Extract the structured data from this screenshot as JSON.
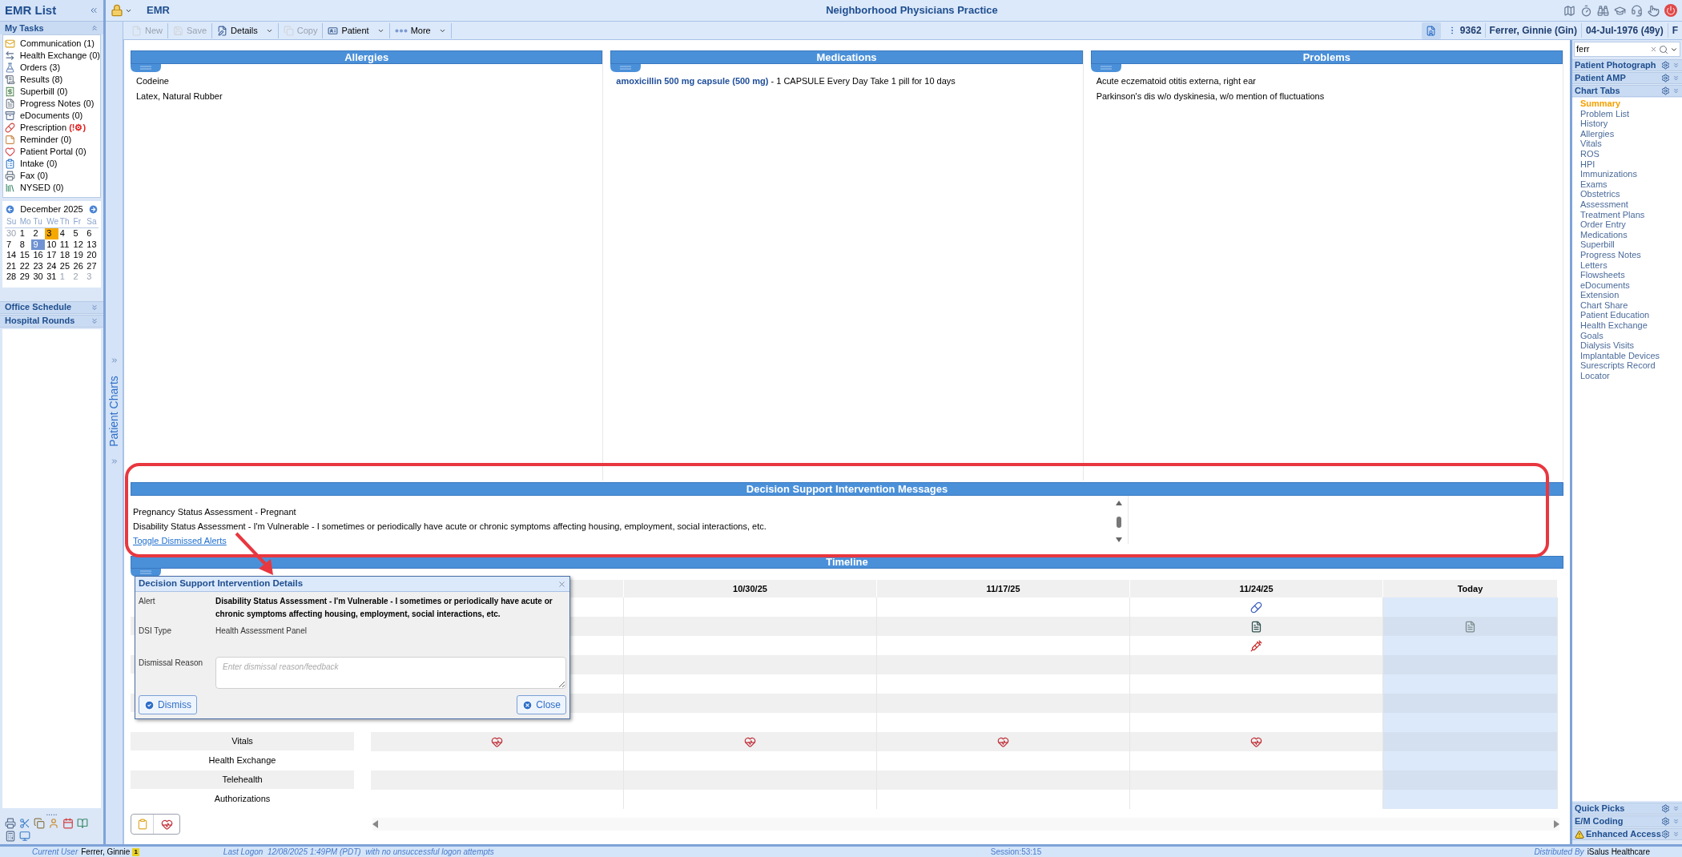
{
  "emr_list": {
    "title": "EMR List",
    "my_tasks": "My Tasks",
    "tasks": [
      {
        "label": "Communication",
        "count": "(1)",
        "kind": "mail",
        "alert": false
      },
      {
        "label": "Health Exchange",
        "count": "(0)",
        "kind": "exchange",
        "alert": false
      },
      {
        "label": "Orders",
        "count": "(3)",
        "kind": "flask",
        "alert": false
      },
      {
        "label": "Results",
        "count": "(8)",
        "kind": "results",
        "alert": false
      },
      {
        "label": "Superbill",
        "count": "(0)",
        "kind": "bill",
        "alert": false
      },
      {
        "label": "Progress Notes",
        "count": "(0)",
        "kind": "notes",
        "alert": false
      },
      {
        "label": "eDocuments",
        "count": "(0)",
        "kind": "cabinet",
        "alert": false
      },
      {
        "label": "Prescription",
        "count": "(!⚙)",
        "kind": "pill",
        "alert": true
      },
      {
        "label": "Reminder",
        "count": "(0)",
        "kind": "sticky",
        "alert": false
      },
      {
        "label": "Patient Portal",
        "count": "(0)",
        "kind": "heart",
        "alert": false
      },
      {
        "label": "Intake",
        "count": "(0)",
        "kind": "intake",
        "alert": false
      },
      {
        "label": "Fax",
        "count": "(0)",
        "kind": "fax",
        "alert": false
      },
      {
        "label": "NYSED",
        "count": "(0)",
        "kind": "books",
        "alert": false
      }
    ],
    "sections": [
      "Office Schedule",
      "Hospital Rounds"
    ],
    "handle": "....."
  },
  "calendar": {
    "month": "December 2025",
    "weekdays": [
      "Su",
      "Mo",
      "Tu",
      "We",
      "Th",
      "Fr",
      "Sa"
    ],
    "weeks": [
      [
        {
          "d": "30",
          "kind": "other",
          "selected": false
        },
        {
          "d": "1",
          "kind": "day",
          "selected": false
        },
        {
          "d": "2",
          "kind": "day",
          "selected": false
        },
        {
          "d": "3",
          "kind": "marked",
          "selected": false
        },
        {
          "d": "4",
          "kind": "day",
          "selected": false
        },
        {
          "d": "5",
          "kind": "day",
          "selected": false
        },
        {
          "d": "6",
          "kind": "day",
          "selected": false
        }
      ],
      [
        {
          "d": "7",
          "kind": "day",
          "selected": false
        },
        {
          "d": "8",
          "kind": "day",
          "selected": false
        },
        {
          "d": "9",
          "kind": "day",
          "selected": true
        },
        {
          "d": "10",
          "kind": "day",
          "selected": false
        },
        {
          "d": "11",
          "kind": "day",
          "selected": false
        },
        {
          "d": "12",
          "kind": "day",
          "selected": false
        },
        {
          "d": "13",
          "kind": "day",
          "selected": false
        }
      ],
      [
        {
          "d": "14",
          "kind": "day",
          "selected": false
        },
        {
          "d": "15",
          "kind": "day",
          "selected": false
        },
        {
          "d": "16",
          "kind": "day",
          "selected": false
        },
        {
          "d": "17",
          "kind": "day",
          "selected": false
        },
        {
          "d": "18",
          "kind": "day",
          "selected": false
        },
        {
          "d": "19",
          "kind": "day",
          "selected": false
        },
        {
          "d": "20",
          "kind": "day",
          "selected": false
        }
      ],
      [
        {
          "d": "21",
          "kind": "day",
          "selected": false
        },
        {
          "d": "22",
          "kind": "day",
          "selected": false
        },
        {
          "d": "23",
          "kind": "day",
          "selected": false
        },
        {
          "d": "24",
          "kind": "day",
          "selected": false
        },
        {
          "d": "25",
          "kind": "day",
          "selected": false
        },
        {
          "d": "26",
          "kind": "day",
          "selected": false
        },
        {
          "d": "27",
          "kind": "day",
          "selected": false
        }
      ],
      [
        {
          "d": "28",
          "kind": "day",
          "selected": false
        },
        {
          "d": "29",
          "kind": "day",
          "selected": false
        },
        {
          "d": "30",
          "kind": "day",
          "selected": false
        },
        {
          "d": "31",
          "kind": "day",
          "selected": false
        },
        {
          "d": "1",
          "kind": "other",
          "selected": false
        },
        {
          "d": "2",
          "kind": "other",
          "selected": false
        },
        {
          "d": "3",
          "kind": "other",
          "selected": false
        }
      ]
    ]
  },
  "app": {
    "module": "EMR",
    "practice": "Neighborhood Physicians Practice",
    "side_tab": "Patient Charts"
  },
  "toolbar": {
    "buttons": [
      {
        "label": "New",
        "kind": "new",
        "disabled": true,
        "dropdown": false
      },
      {
        "label": "Save",
        "kind": "save",
        "disabled": true,
        "dropdown": false
      },
      {
        "label": "Details",
        "kind": "details",
        "disabled": false,
        "dropdown": true
      },
      {
        "label": "Copy",
        "kind": "copy",
        "disabled": true,
        "dropdown": false
      },
      {
        "label": "Patient",
        "kind": "patient",
        "disabled": false,
        "dropdown": true
      },
      {
        "label": "More",
        "kind": "more",
        "disabled": false,
        "dropdown": true
      }
    ]
  },
  "patient": {
    "id": "9362",
    "name": "Ferrer, Ginnie (Gin)",
    "dob": "04-Jul-1976 (49y)",
    "sex": "F"
  },
  "panels": [
    {
      "title": "Allergies",
      "lines": [
        "Codeine",
        "Latex, Natural Rubber"
      ]
    },
    {
      "title": "Medications",
      "lines": [
        "**amoxicillin 500 mg capsule (500 mg)** - 1 CAPSULE Every Day Take 1 pill for 10 days"
      ]
    },
    {
      "title": "Problems",
      "lines": [
        "Acute eczematoid otitis externa, right ear",
        "Parkinson's dis w/o dyskinesia, w/o mention of fluctuations"
      ]
    }
  ],
  "dsi": {
    "title": "Decision Support Intervention Messages",
    "alerts": [
      "Pregnancy Status Assessment - Pregnant",
      "Disability Status Assessment - I'm Vulnerable - I sometimes or periodically have acute or chronic symptoms affecting housing, employment, social interactions, etc."
    ],
    "toggle_link": "Toggle Dismissed Alerts"
  },
  "timeline": {
    "title": "Timeline",
    "columns": [
      {
        "label": "10/30/25",
        "today": false
      },
      {
        "label": "11/17/25",
        "today": false
      },
      {
        "label": "11/24/25",
        "today": false
      },
      {
        "label": "Today",
        "today": true
      }
    ],
    "rows": [
      {
        "cells": [
          {
            "kind": "empty"
          },
          {
            "kind": "empty"
          },
          {
            "kind": "empty"
          },
          {
            "kind": "pills"
          },
          {
            "kind": "empty"
          }
        ]
      },
      {
        "cells": [
          {
            "kind": "empty"
          },
          {
            "kind": "empty"
          },
          {
            "kind": "empty"
          },
          {
            "kind": "document"
          },
          {
            "kind": "draft"
          }
        ]
      },
      {
        "cells": [
          {
            "kind": "empty"
          },
          {
            "kind": "empty"
          },
          {
            "kind": "empty"
          },
          {
            "kind": "syringe"
          },
          {
            "kind": "empty"
          }
        ]
      },
      {
        "cells": [
          {
            "kind": "empty"
          },
          {
            "kind": "empty"
          },
          {
            "kind": "empty"
          },
          {
            "kind": "empty"
          },
          {
            "kind": "empty"
          }
        ]
      },
      {
        "cells": [
          {
            "kind": "empty"
          },
          {
            "kind": "empty"
          },
          {
            "kind": "empty"
          },
          {
            "kind": "empty"
          },
          {
            "kind": "empty"
          }
        ]
      },
      {
        "cells": [
          {
            "kind": "empty"
          },
          {
            "kind": "empty"
          },
          {
            "kind": "empty"
          },
          {
            "kind": "empty"
          },
          {
            "kind": "empty"
          }
        ]
      },
      {
        "cells": [
          {
            "kind": "empty"
          },
          {
            "kind": "empty"
          },
          {
            "kind": "empty"
          },
          {
            "kind": "empty"
          },
          {
            "kind": "empty"
          }
        ]
      },
      {
        "label": "Vitals",
        "cells": [
          {
            "kind": "heart"
          },
          {
            "kind": "heart"
          },
          {
            "kind": "heart"
          },
          {
            "kind": "heart"
          },
          {
            "kind": "empty"
          }
        ]
      },
      {
        "label": "Health Exchange",
        "cells": [
          {
            "kind": "empty"
          },
          {
            "kind": "empty"
          },
          {
            "kind": "empty"
          },
          {
            "kind": "empty"
          },
          {
            "kind": "empty"
          }
        ]
      },
      {
        "label": "Telehealth",
        "cells": [
          {
            "kind": "empty"
          },
          {
            "kind": "empty"
          },
          {
            "kind": "empty"
          },
          {
            "kind": "empty"
          },
          {
            "kind": "empty"
          }
        ]
      },
      {
        "label": "Authorizations",
        "cells": [
          {
            "kind": "empty"
          },
          {
            "kind": "empty"
          },
          {
            "kind": "empty"
          },
          {
            "kind": "empty"
          },
          {
            "kind": "empty"
          }
        ]
      }
    ]
  },
  "dialog": {
    "title": "Decision Support Intervention Details",
    "fields": [
      {
        "label": "Alert",
        "kind": "bold",
        "value": "Disability Status Assessment - I'm Vulnerable - I sometimes or periodically have acute or chronic symptoms affecting housing, employment, social interactions, etc."
      },
      {
        "label": "DSI Type",
        "kind": "text",
        "value": "Health Assessment Panel"
      },
      {
        "label": "Dismissal Reason",
        "kind": "textarea",
        "placeholder": "Enter dismissal reason/feedback"
      }
    ],
    "buttons": [
      {
        "label": "Dismiss",
        "kind": "check"
      },
      {
        "label": "Close",
        "kind": "close"
      }
    ]
  },
  "right_panel": {
    "search": {
      "value": "ferr"
    },
    "sections": [
      "Patient Photograph",
      "Patient AMP",
      "Chart Tabs"
    ],
    "chart_tabs": [
      {
        "label": "Summary",
        "selected": true
      },
      {
        "label": "Problem List",
        "selected": false
      },
      {
        "label": "History",
        "selected": false
      },
      {
        "label": "Allergies",
        "selected": false
      },
      {
        "label": "Vitals",
        "selected": false
      },
      {
        "label": "ROS",
        "selected": false
      },
      {
        "label": "HPI",
        "selected": false
      },
      {
        "label": "Immunizations",
        "selected": false
      },
      {
        "label": "Exams",
        "selected": false
      },
      {
        "label": "Obstetrics",
        "selected": false
      },
      {
        "label": "Assessment",
        "selected": false
      },
      {
        "label": "Treatment Plans",
        "selected": false
      },
      {
        "label": "Order Entry",
        "selected": false
      },
      {
        "label": "Medications",
        "selected": false
      },
      {
        "label": "Superbill",
        "selected": false
      },
      {
        "label": "Progress Notes",
        "selected": false
      },
      {
        "label": "Letters",
        "selected": false
      },
      {
        "label": "Flowsheets",
        "selected": false
      },
      {
        "label": "eDocuments",
        "selected": false
      },
      {
        "label": "Extension",
        "selected": false
      },
      {
        "label": "Chart Share",
        "selected": false
      },
      {
        "label": "Patient Education",
        "selected": false
      },
      {
        "label": "Health Exchange",
        "selected": false
      },
      {
        "label": "Goals",
        "selected": false
      },
      {
        "label": "Dialysis Visits",
        "selected": false
      },
      {
        "label": "Implantable Devices",
        "selected": false
      },
      {
        "label": "Surescripts Record",
        "selected": false
      },
      {
        "label": "Locator",
        "selected": false
      }
    ],
    "bottom_sections": [
      {
        "label": "Quick Picks",
        "warning": false
      },
      {
        "label": "E/M Coding",
        "warning": false
      },
      {
        "label": "Enhanced Access",
        "warning": true
      }
    ]
  },
  "status_bar": {
    "user_label": "Current User",
    "user": "Ferrer, Ginnie",
    "user_badge": "1",
    "logon": "Last Logon  12/08/2025 1:49PM (PDT)  with no unsuccessful logon attempts",
    "session": "Session:53:15",
    "dist_label": "Distributed By",
    "dist": "iSalus Healthcare"
  }
}
